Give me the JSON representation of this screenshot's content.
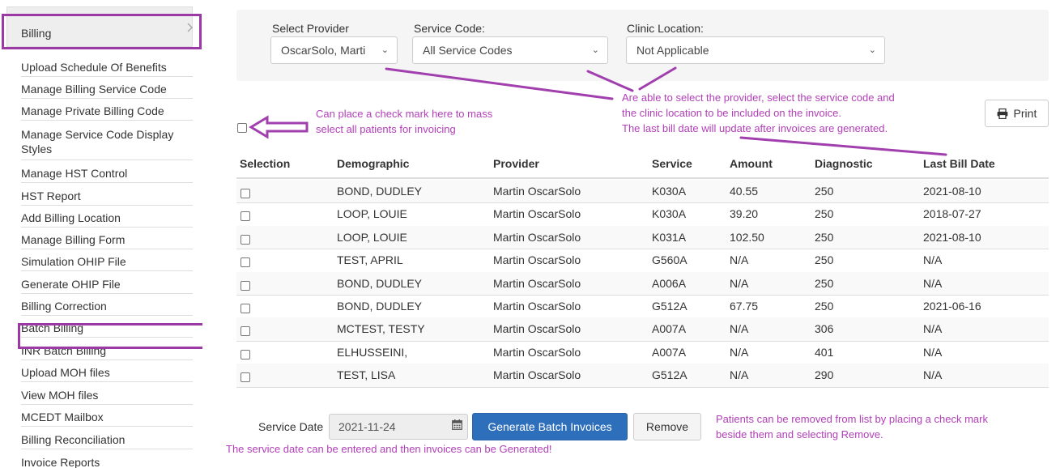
{
  "sidebar": {
    "header": "Billing",
    "items": [
      "Upload Schedule Of Benefits",
      "Manage Billing Service Code",
      "Manage Private Billing Code",
      "Manage Service Code Display Styles",
      "Manage HST Control",
      "HST Report",
      "Add Billing Location",
      "Manage Billing Form",
      "Simulation OHIP File",
      "Generate OHIP File",
      "Billing Correction",
      "Batch Billing",
      "INR Batch Billing",
      "Upload MOH files",
      "View MOH files",
      "MCEDT Mailbox",
      "Billing Reconciliation",
      "Invoice Reports"
    ]
  },
  "filters": {
    "provider_label": "Select Provider",
    "provider_value": "OscarSolo, Marti",
    "service_code_label": "Service Code:",
    "service_code_value": "All Service Codes",
    "clinic_location_label": "Clinic Location:",
    "clinic_location_value": "Not Applicable"
  },
  "print_label": "Print",
  "annotations": {
    "select_all_line1": "Can place a check mark here to mass",
    "select_all_line2": "select all patients for invoicing",
    "filters_line1": "Are able to select the provider, select the service code and",
    "filters_line2": "the clinic location to be included on the invoice.",
    "filters_line3": "The last bill date will update after invoices are generated.",
    "remove_line1": "Patients can be removed from list by placing a check mark",
    "remove_line2": "beside them and selecting Remove.",
    "service_date": "The service date can be entered and then invoices can be Generated!"
  },
  "table": {
    "columns": [
      "Selection",
      "Demographic",
      "Provider",
      "Service",
      "Amount",
      "Diagnostic",
      "Last Bill Date"
    ],
    "rows": [
      [
        "BOND, DUDLEY",
        "Martin OscarSolo",
        "K030A",
        "40.55",
        "250",
        "2021-08-10"
      ],
      [
        "LOOP, LOUIE",
        "Martin OscarSolo",
        "K030A",
        "39.20",
        "250",
        "2018-07-27"
      ],
      [
        "LOOP, LOUIE",
        "Martin OscarSolo",
        "K031A",
        "102.50",
        "250",
        "2021-08-10"
      ],
      [
        "TEST, APRIL",
        "Martin OscarSolo",
        "G560A",
        "N/A",
        "250",
        "N/A"
      ],
      [
        "BOND, DUDLEY",
        "Martin OscarSolo",
        "A006A",
        "N/A",
        "250",
        "N/A"
      ],
      [
        "BOND, DUDLEY",
        "Martin OscarSolo",
        "G512A",
        "67.75",
        "250",
        "2021-06-16"
      ],
      [
        "MCTEST, TESTY",
        "Martin OscarSolo",
        "A007A",
        "N/A",
        "306",
        "N/A"
      ],
      [
        "ELHUSSEINI,",
        "Martin OscarSolo",
        "A007A",
        "N/A",
        "401",
        "N/A"
      ],
      [
        "TEST, LISA",
        "Martin OscarSolo",
        "G512A",
        "N/A",
        "290",
        "N/A"
      ]
    ]
  },
  "service_date_label": "Service Date",
  "service_date_value": "2021-11-24",
  "generate_label": "Generate Batch Invoices",
  "remove_label": "Remove",
  "colors": {
    "annotation": "#b23fb8",
    "highlight_border": "#9b3aa4",
    "primary_button": "#2e6fbc"
  }
}
